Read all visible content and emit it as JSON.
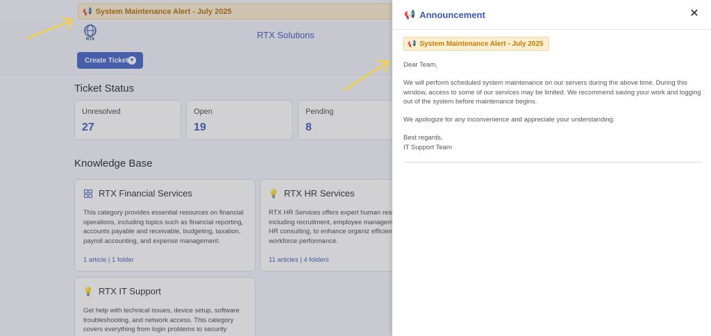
{
  "alert": {
    "text": "System Maintenance Alert - July 2025"
  },
  "header": {
    "brand": "RTX Solutions",
    "logo_text": "RTX",
    "create_ticket": "Create Ticket"
  },
  "ticket_status": {
    "title": "Ticket Status",
    "cards": [
      {
        "label": "Unresolved",
        "value": "27"
      },
      {
        "label": "Open",
        "value": "19"
      },
      {
        "label": "Pending",
        "value": "8"
      }
    ]
  },
  "knowledge_base": {
    "title": "Knowledge Base",
    "cards": [
      {
        "title": "RTX Financial Services",
        "desc": "This category provides essential resources on financial operations, including topics such as financial reporting, accounts payable and receivable, budgeting, taxation, payroll accounting, and expense management.",
        "meta": "1 article | 1 folder"
      },
      {
        "title": "RTX HR Services",
        "desc": "RTX HR Services offers expert human resources including recruitment, employee management strategic HR consulting, to enhance organiz efficiency and workforce performance.",
        "meta": "11 articles | 4 folders"
      },
      {
        "title": "RTX IT Support",
        "desc": "Get help with technical issues, device setup, software troubleshooting, and network access. This category covers everything from login problems to security",
        "meta": ""
      }
    ]
  },
  "drawer": {
    "title": "Announcement",
    "alert": "System Maintenance Alert - July 2025",
    "greeting": "Dear Team,",
    "para1": "We will perform scheduled system maintenance on our servers during the above time. During this window, access to some of our services may be limited. We recommend saving your work and logging out of the system before maintenance begins.",
    "para2": "We apologize for any inconvenience and appreciate your understanding.",
    "signoff1": "Best regards,",
    "signoff2": "IT Support Team"
  },
  "colors": {
    "accent": "#3e56b8",
    "alert_bg": "#fdeecf",
    "alert_text": "#c77a00",
    "arrow": "#f2d33c"
  },
  "icons": {
    "megaphone": "megaphone-icon",
    "close": "close-icon",
    "chevron": "chevron-down-icon",
    "grid": "grid-icon",
    "bulb": "lightbulb-icon"
  }
}
